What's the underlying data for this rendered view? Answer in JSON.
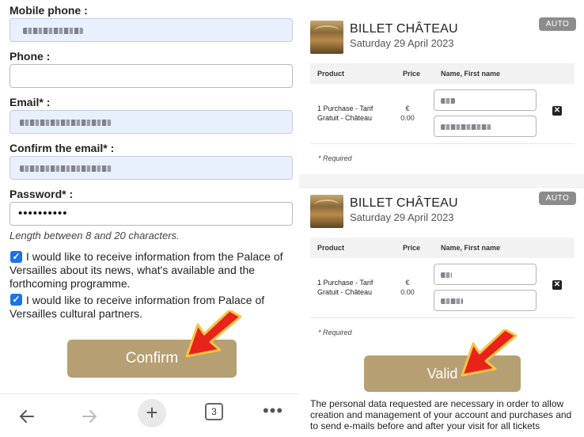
{
  "signup_form": {
    "mobile_phone_label": "Mobile phone :",
    "phone_label": "Phone :",
    "email_label": "Email* :",
    "confirm_email_label": "Confirm the email* :",
    "password_label": "Password* :",
    "password_value": "••••••••••",
    "password_hint": "Length between 8 and 20 characters.",
    "checkbox_palace_news": "I would like to receive information from the Palace of Versailles about its news, what's available and the forthcoming programme.",
    "checkbox_partners": "I would like to receive information from Palace of Versailles cultural partners.",
    "confirm_button": "Confirm"
  },
  "browser_toolbar": {
    "back_icon": "arrow-left-icon",
    "forward_icon": "arrow-right-icon",
    "new_tab_icon": "plus-icon",
    "tab_count": "3",
    "menu_icon": "more-horizontal-icon"
  },
  "tickets": [
    {
      "title": "BILLET CHÂTEAU",
      "date": "Saturday 29 April 2023",
      "badge": "AUTO",
      "headers": {
        "product": "Product",
        "price": "Price",
        "name": "Name, First name"
      },
      "product_line1": "1 Purchase - Tarif",
      "product_line2": "Gratuit - Château",
      "currency": "€",
      "price": "0.00",
      "required_note": "* Required"
    },
    {
      "title": "BILLET CHÂTEAU",
      "date": "Saturday 29 April 2023",
      "badge": "AUTO",
      "headers": {
        "product": "Product",
        "price": "Price",
        "name": "Name, First name"
      },
      "product_line1": "1 Purchase - Tarif",
      "product_line2": "Gratuit - Château",
      "currency": "€",
      "price": "0.00",
      "required_note": "* Required"
    }
  ],
  "valid_button": "Valid",
  "footer_text": "The personal data requested are necessary in order to allow creation and management of your account and purchases and to send e-mails before and after your visit for all tickets",
  "colors": {
    "gold_button": "#b69f72",
    "autofill_bg": "#e8f0fe",
    "checkbox_blue": "#1a73e8",
    "arrow_red": "#e8231b",
    "arrow_outline": "#f5c542"
  }
}
